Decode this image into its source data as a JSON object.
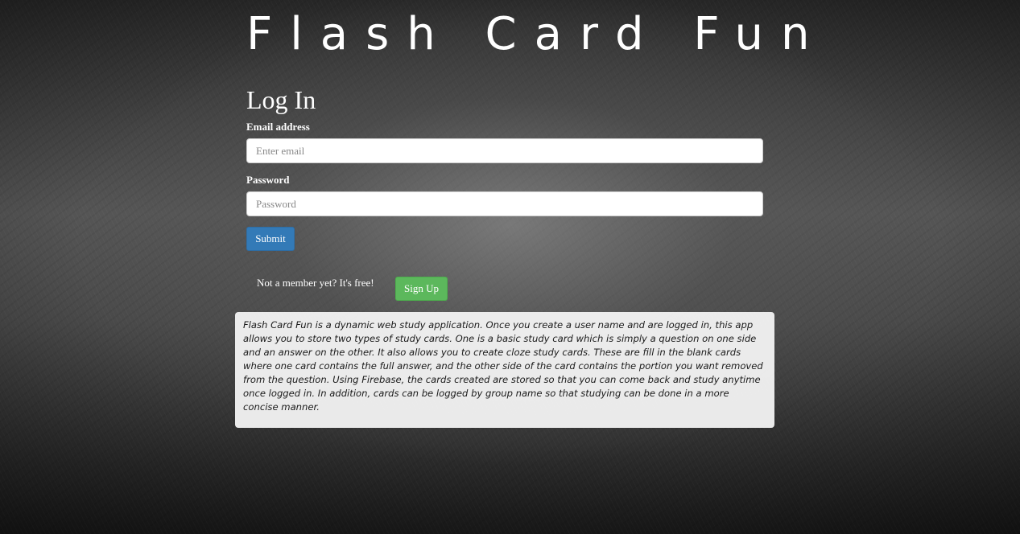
{
  "header": {
    "app_title": "Flash Card Fun"
  },
  "login_form": {
    "heading": "Log In",
    "email_label": "Email address",
    "email_placeholder": "Enter email",
    "email_value": "",
    "password_label": "Password",
    "password_placeholder": "Password",
    "password_value": "",
    "submit_label": "Submit"
  },
  "signup": {
    "prompt": "Not a member yet? It's free!",
    "button_label": "Sign Up"
  },
  "about": {
    "description": "Flash Card Fun is a dynamic web study application. Once you create a user name and are logged in, this app allows you to store two types of study cards. One is a basic study card which is simply a question on one side and an answer on the other. It also allows you to create cloze study cards. These are fill in the blank cards where one card contains the full answer, and the other side of the card contains the portion you want removed from the question. Using Firebase, the cards created are stored so that you can come back and study anytime once logged in. In addition, cards can be logged by group name so that studying can be done in a more concise manner."
  },
  "colors": {
    "submit_button": "#337ab7",
    "signup_button": "#5cb85c",
    "panel_background": "#f0f0f0"
  }
}
